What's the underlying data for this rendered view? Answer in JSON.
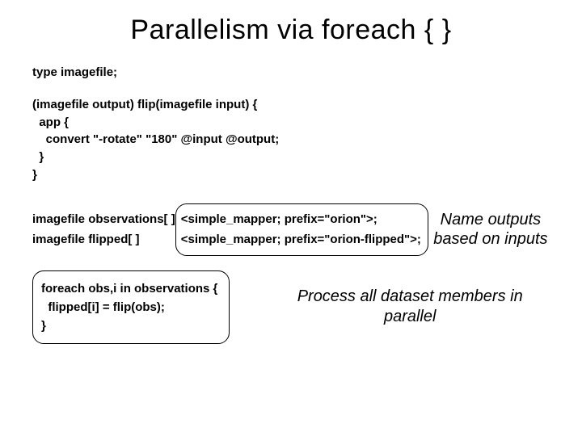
{
  "title": "Parallelism via foreach { }",
  "code": {
    "typedef": "type imagefile;",
    "fn": "(imagefile output) flip(imagefile input) {\n  app {\n    convert \"-rotate\" \"180\" @input @output;\n  }\n}",
    "decl_left": "imagefile observations[ ]\nimagefile flipped[ ]",
    "mapper_bubble": "<simple_mapper; prefix=\"orion\">;\n<simple_mapper; prefix=\"orion-flipped\">;",
    "foreach_bubble": "foreach obs,i in observations {\n  flipped[i] = flip(obs);\n}"
  },
  "annotations": {
    "name_outputs": "Name\noutputs\nbased on inputs",
    "process_all": "Process all\ndataset members\nin parallel"
  }
}
